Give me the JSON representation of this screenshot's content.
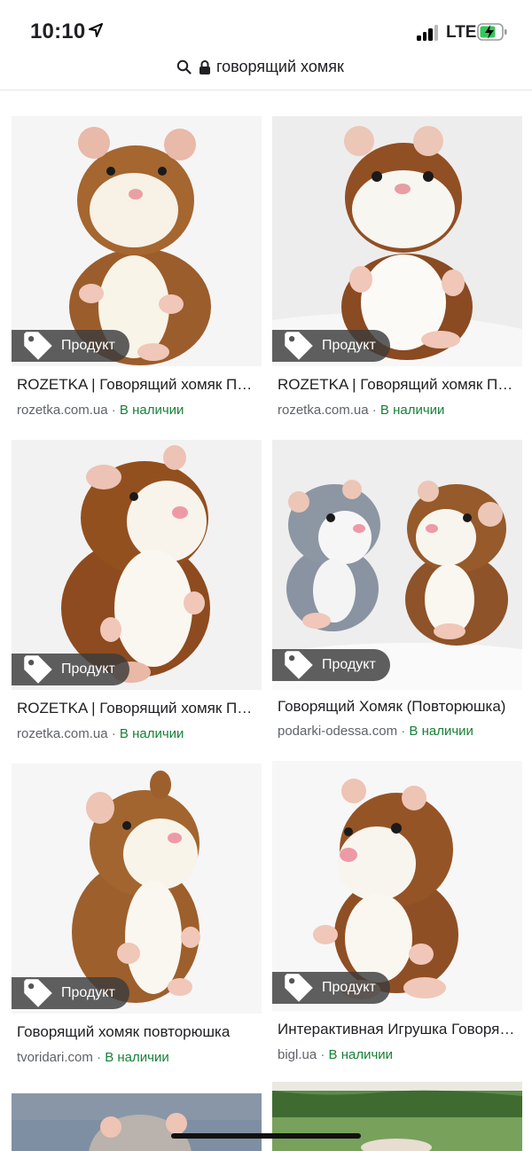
{
  "status_bar": {
    "time": "10:10",
    "network": "LTE"
  },
  "address_bar": {
    "query": "говорящий хомяк"
  },
  "results": [
    {
      "title": "ROZETKA | Говорящий хомяк Повторюшка",
      "domain": "rozetka.com.ua",
      "availability": "В наличии",
      "badge": "Продукт"
    },
    {
      "title": "ROZETKA | Говорящий хомяк Повторюшка",
      "domain": "rozetka.com.ua",
      "availability": "В наличии",
      "badge": "Продукт"
    },
    {
      "title": "ROZETKA | Говорящий хомяк Повторюшка",
      "domain": "rozetka.com.ua",
      "availability": "В наличии",
      "badge": "Продукт"
    },
    {
      "title": "Говорящий Хомяк (Повторюшка)",
      "domain": "podarki-odessa.com",
      "availability": "В наличии",
      "badge": "Продукт"
    },
    {
      "title": "Говорящий хомяк повторюшка",
      "domain": "tvoridari.com",
      "availability": "В наличии",
      "badge": "Продукт"
    },
    {
      "title": "Интерактивная Игрушка Говорящий хомяк",
      "domain": "bigl.ua",
      "availability": "В наличии",
      "badge": "Продукт"
    }
  ],
  "separator": "·",
  "colors": {
    "availability": "#188038",
    "domain": "#5f6368",
    "badge_bg": "#3c3c3c",
    "hamster_brown": "#9a5a2a",
    "hamster_gray": "#8d96a3"
  }
}
